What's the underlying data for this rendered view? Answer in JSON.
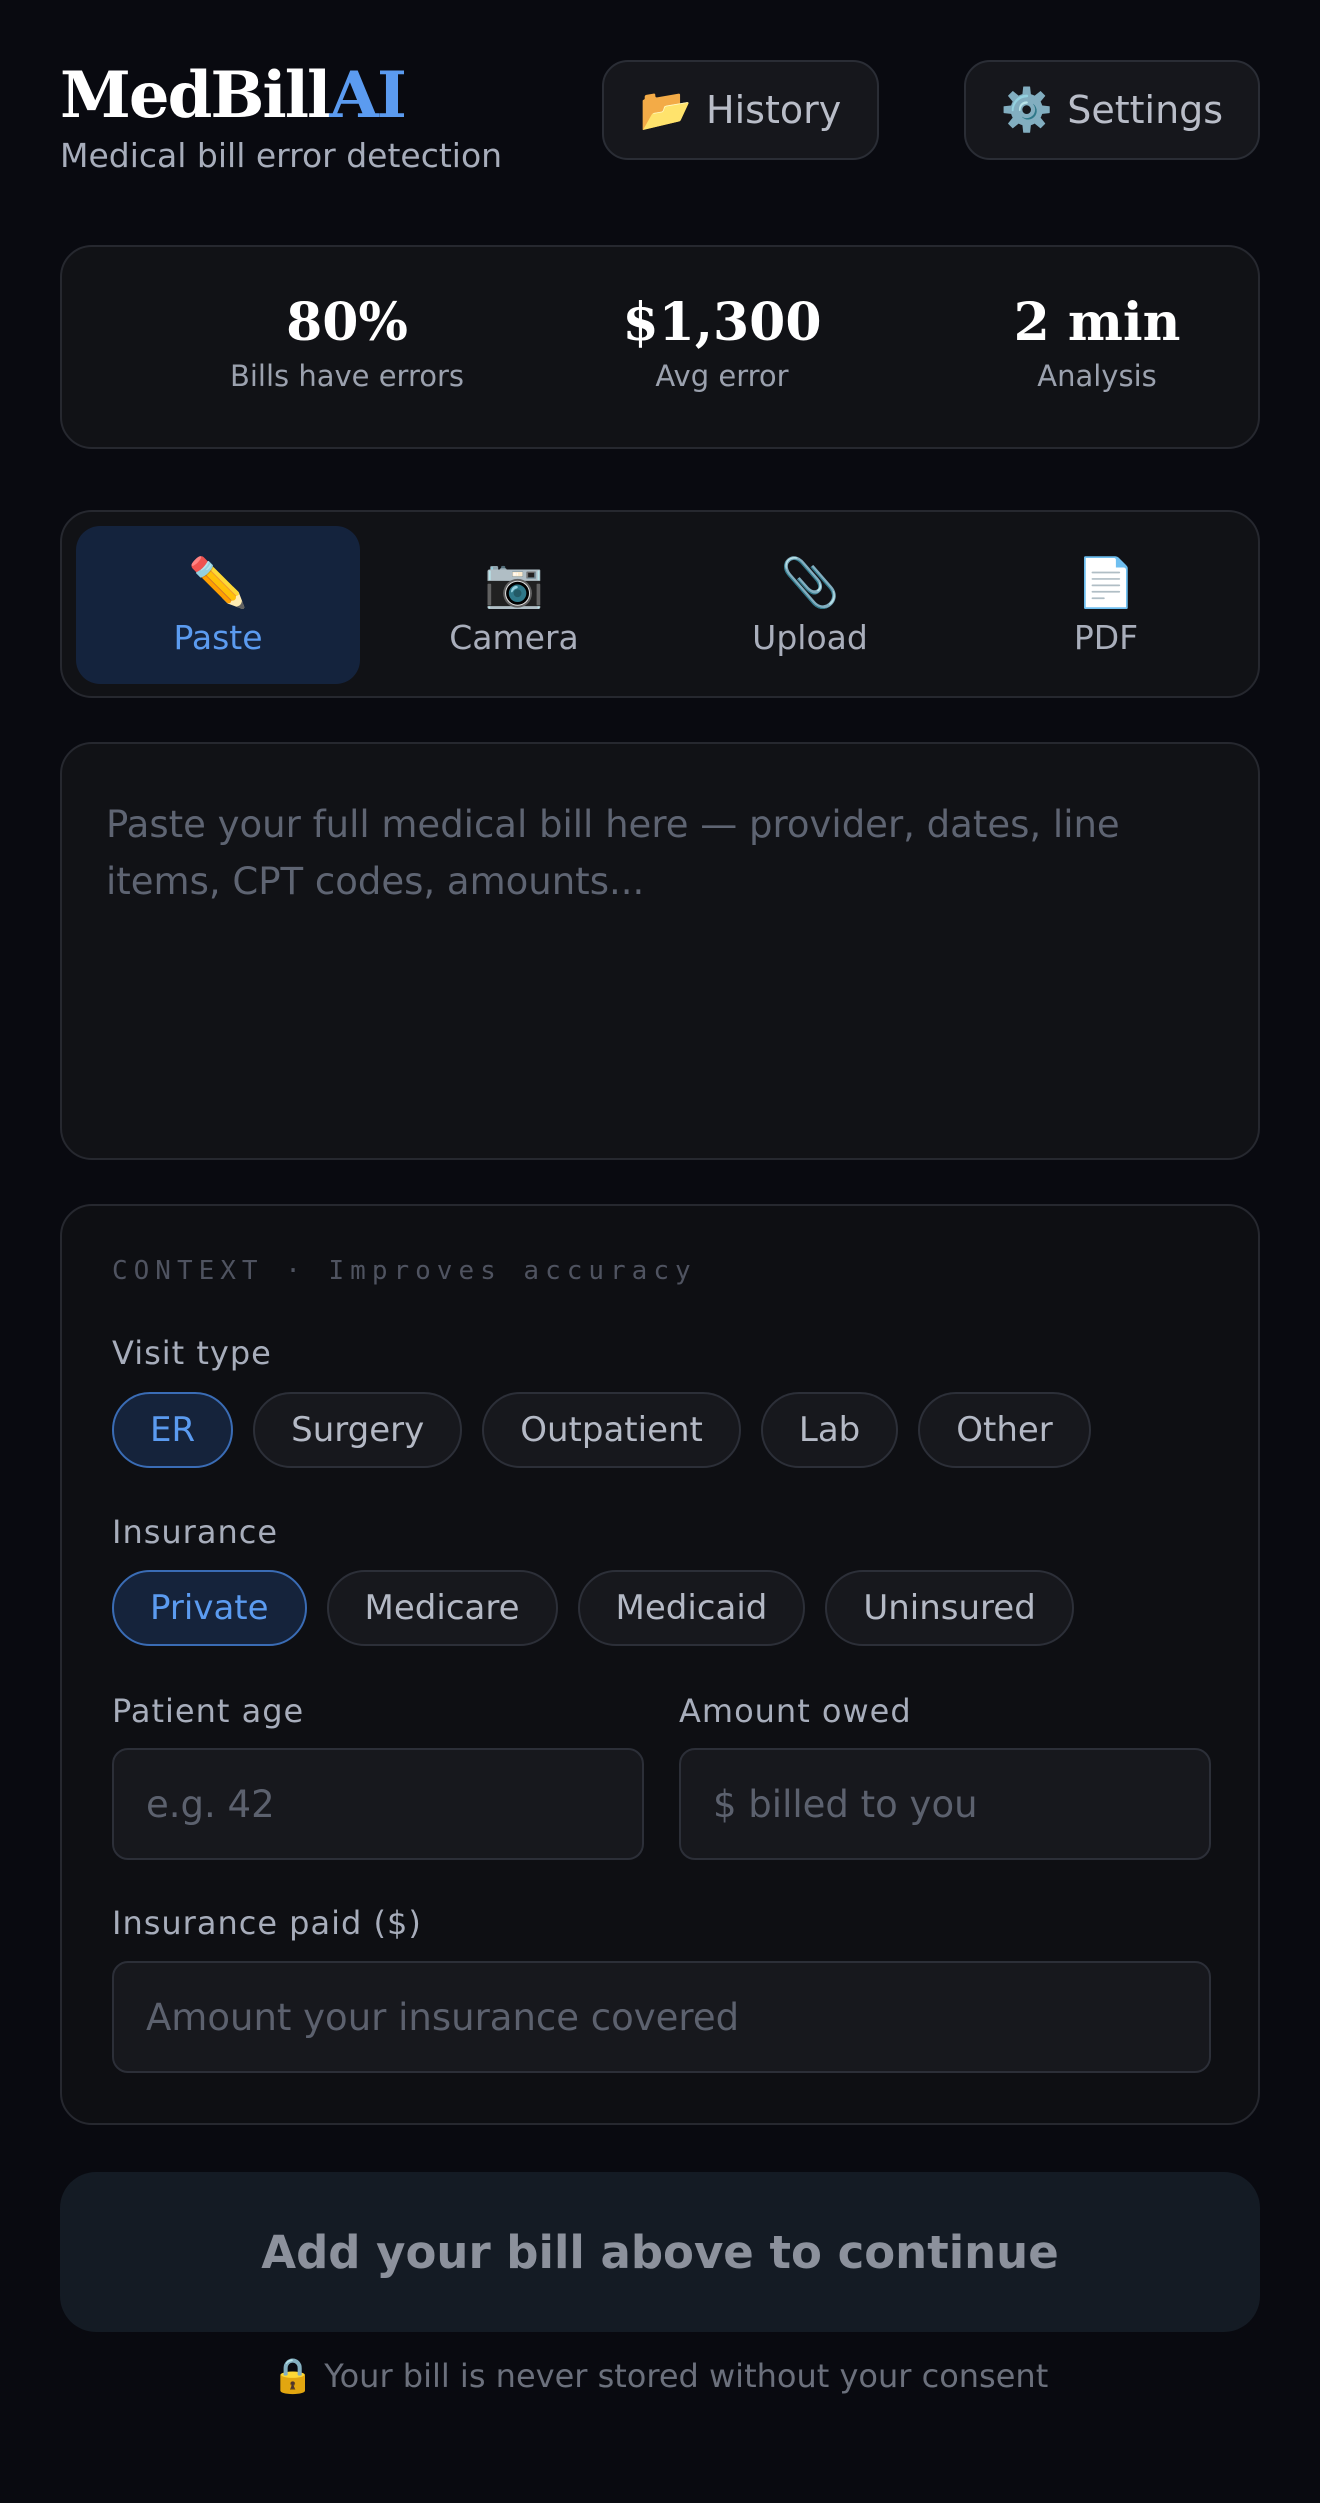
{
  "header": {
    "logo_main": "MedBill",
    "logo_accent": "AI",
    "tagline": "Medical bill error detection",
    "history_icon": "📂",
    "history_label": "History",
    "settings_icon": "⚙️",
    "settings_label": "Settings"
  },
  "stats": [
    {
      "value": "80%",
      "label": "Bills have errors"
    },
    {
      "value": "$1,300",
      "label": "Avg error"
    },
    {
      "value": "2 min",
      "label": "Analysis"
    }
  ],
  "tabs": [
    {
      "icon": "✏️",
      "icon_name": "pencil-icon",
      "label": "Paste",
      "active": true
    },
    {
      "icon": "📷",
      "icon_name": "camera-icon",
      "label": "Camera",
      "active": false
    },
    {
      "icon": "📎",
      "icon_name": "paperclip-icon",
      "label": "Upload",
      "active": false
    },
    {
      "icon": "📄",
      "icon_name": "document-icon",
      "label": "PDF",
      "active": false
    }
  ],
  "paste": {
    "placeholder": "Paste your full medical bill here — provider, dates, line items, CPT codes, amounts..."
  },
  "context": {
    "heading": "CONTEXT · Improves accuracy",
    "visit_type_label": "Visit type",
    "visit_types": [
      "ER",
      "Surgery",
      "Outpatient",
      "Lab",
      "Other"
    ],
    "visit_type_selected": "ER",
    "insurance_label": "Insurance",
    "insurance_types": [
      "Private",
      "Medicare",
      "Medicaid",
      "Uninsured"
    ],
    "insurance_selected": "Private",
    "age_label": "Patient age",
    "age_placeholder": "e.g. 42",
    "owed_label": "Amount owed",
    "owed_placeholder": "$ billed to you",
    "paid_label": "Insurance paid ($)",
    "paid_placeholder": "Amount your insurance covered"
  },
  "cta": {
    "label": "Add your bill above to continue"
  },
  "privacy": {
    "icon": "🔒",
    "text": "Your bill is never stored without your consent"
  },
  "colors": {
    "accent": "#5b9bf0",
    "background": "#090a10",
    "card": "#111216"
  }
}
